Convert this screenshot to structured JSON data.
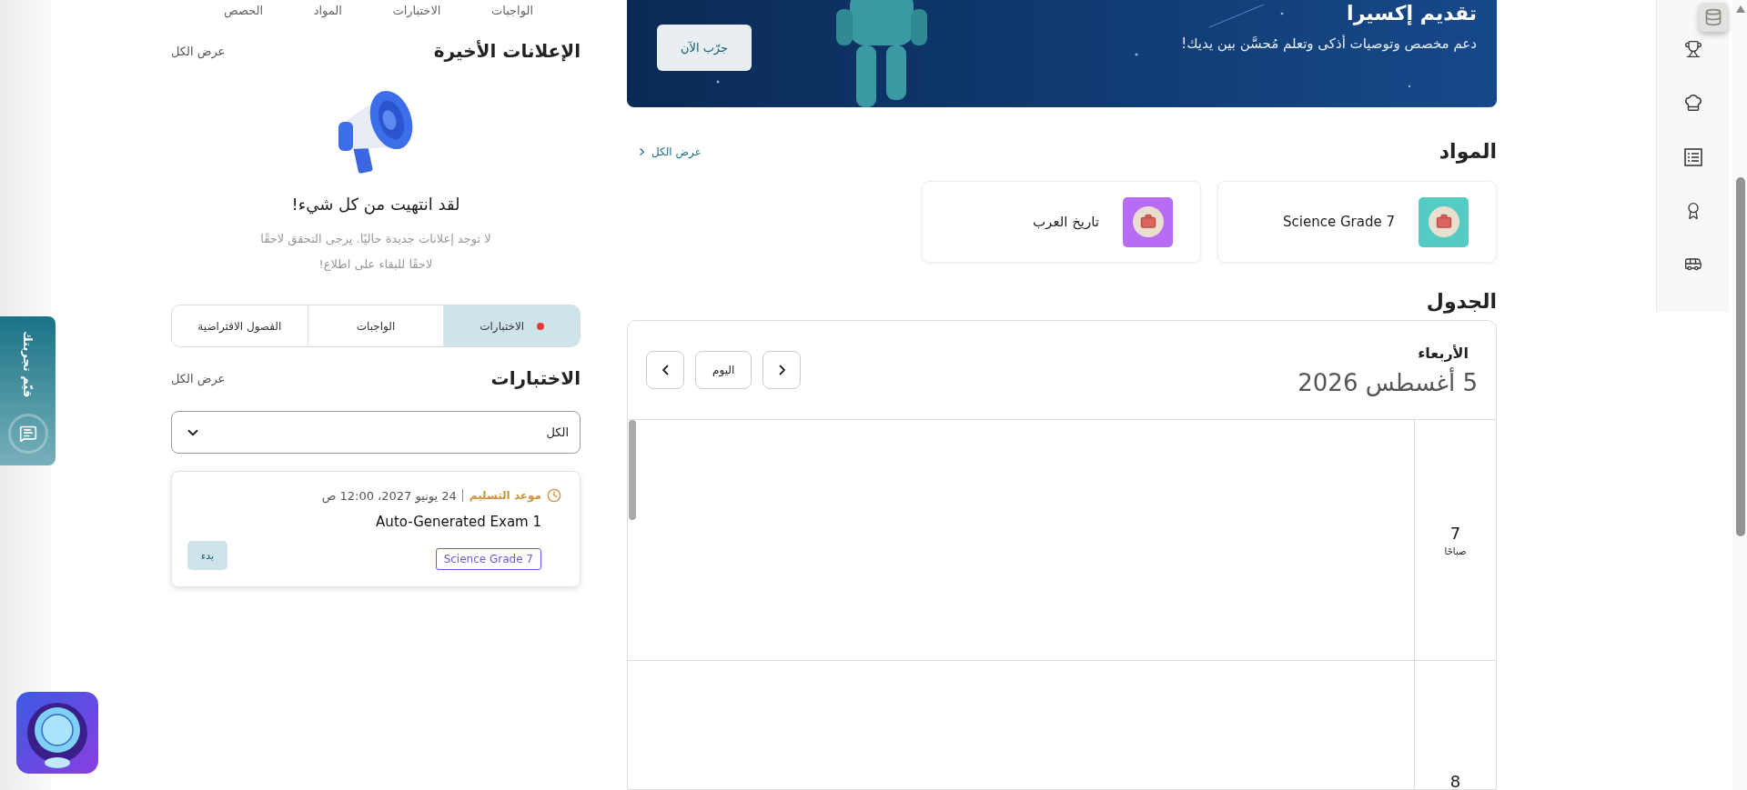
{
  "top_links": [
    {
      "label": "الواجبات"
    },
    {
      "label": "الاختبارات"
    },
    {
      "label": "المواد"
    },
    {
      "label": "الحصص"
    }
  ],
  "announcements": {
    "title": "الإعلانات الأخيرة",
    "view_all": "عرض الكل",
    "empty_title": "لقد انتهيت من كل شيء!",
    "empty_lines": [
      "لا توجد إعلانات جديدة حاليًا. يرجى التحقق لاحقًا",
      "لاحقًا للبقاء على اطلاع!"
    ]
  },
  "tabs": [
    {
      "label": "الاختبارات",
      "selected": true,
      "alert": true
    },
    {
      "label": "الواجبات",
      "selected": false,
      "alert": false
    },
    {
      "label": "الفصول الافتراضية",
      "selected": false,
      "alert": false
    }
  ],
  "exams": {
    "title": "الاختبارات",
    "view_all": "عرض الكل",
    "filter": {
      "value": "الكل"
    },
    "items": [
      {
        "deadline_label": "موعد التسليم",
        "deadline": "24 يونيو 2027، 12:00 ص",
        "title": "Auto-Generated Exam 1",
        "subject": "Science Grade 7",
        "action": "بدء"
      }
    ]
  },
  "banner": {
    "title": "تقديم إكسيرا",
    "subtitle": "دعم مخصص وتوصيات أذكى وتعلم مُحسَّن بين يديك!",
    "button": "جرّب الآن"
  },
  "subjects": {
    "title": "المواد",
    "view_all": "عرض الكل",
    "items": [
      {
        "name": "Science Grade 7",
        "color": "#55cbc4"
      },
      {
        "name": "تاريخ العرب",
        "color": "#b86cf5"
      }
    ]
  },
  "schedule": {
    "title": "الجدول",
    "weekday": "الأربعاء",
    "date": "5 أغسطس 2026",
    "today": "اليوم",
    "hours": [
      {
        "hour": "7",
        "period": "صباحًا"
      },
      {
        "hour": "8"
      }
    ]
  },
  "feedback": {
    "label": "قيّم تجربتك"
  }
}
